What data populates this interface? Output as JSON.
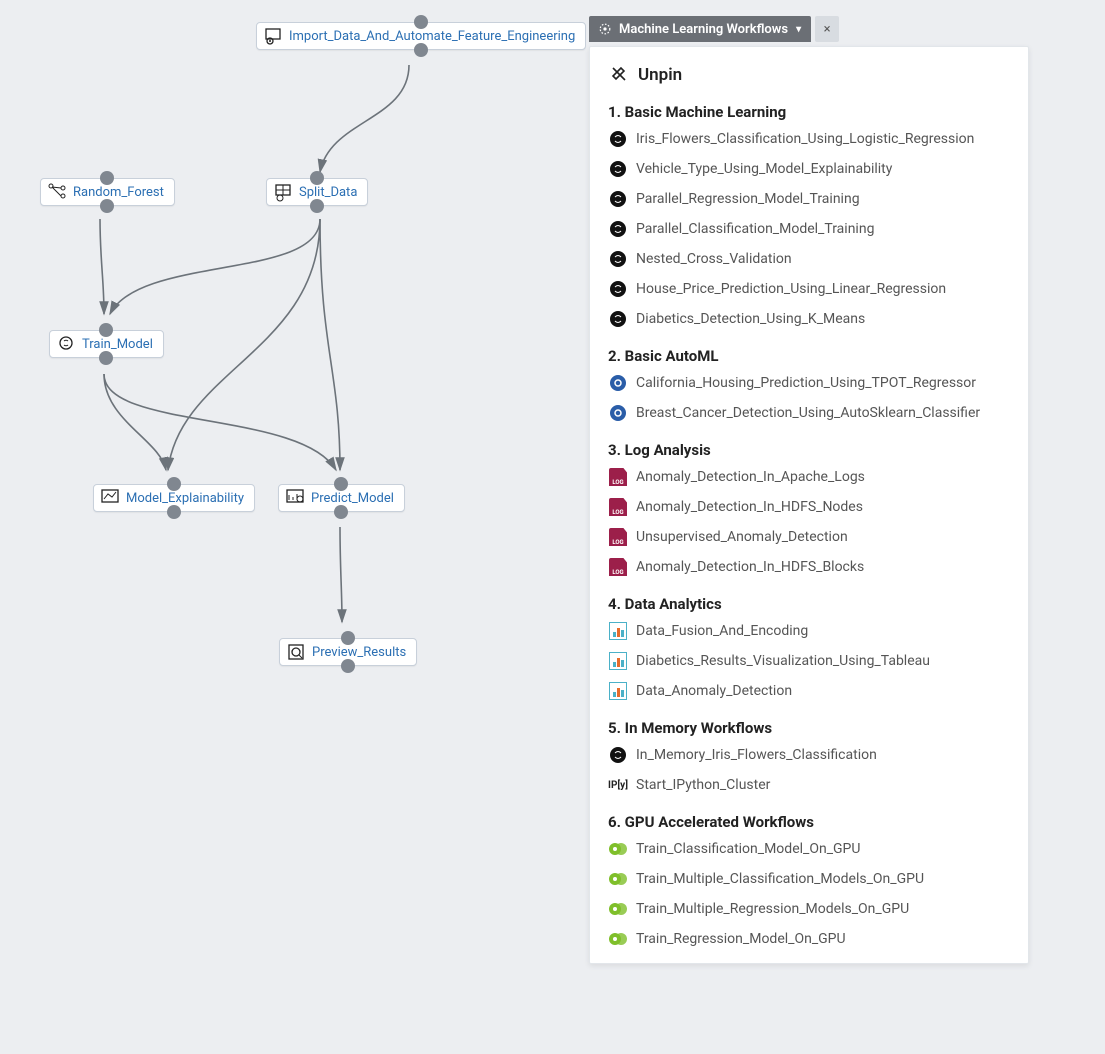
{
  "panel": {
    "tab_label": "Machine Learning Workflows",
    "unpin_label": "Unpin",
    "sections": {
      "s1": {
        "title": "1. Basic Machine Learning",
        "items": [
          "Iris_Flowers_Classification_Using_Logistic_Regression",
          "Vehicle_Type_Using_Model_Explainability",
          "Parallel_Regression_Model_Training",
          "Parallel_Classification_Model_Training",
          "Nested_Cross_Validation",
          "House_Price_Prediction_Using_Linear_Regression",
          "Diabetics_Detection_Using_K_Means"
        ]
      },
      "s2": {
        "title": "2. Basic AutoML",
        "items": [
          "California_Housing_Prediction_Using_TPOT_Regressor",
          "Breast_Cancer_Detection_Using_AutoSklearn_Classifier"
        ]
      },
      "s3": {
        "title": "3. Log Analysis",
        "items": [
          "Anomaly_Detection_In_Apache_Logs",
          "Anomaly_Detection_In_HDFS_Nodes",
          "Unsupervised_Anomaly_Detection",
          "Anomaly_Detection_In_HDFS_Blocks"
        ]
      },
      "s4": {
        "title": "4. Data Analytics",
        "items": [
          "Data_Fusion_And_Encoding",
          "Diabetics_Results_Visualization_Using_Tableau",
          "Data_Anomaly_Detection"
        ]
      },
      "s5": {
        "title": "5. In Memory Workflows",
        "items": [
          "In_Memory_Iris_Flowers_Classification",
          "Start_IPython_Cluster"
        ]
      },
      "s6": {
        "title": "6. GPU Accelerated Workflows",
        "items": [
          "Train_Classification_Model_On_GPU",
          "Train_Multiple_Classification_Models_On_GPU",
          "Train_Multiple_Regression_Models_On_GPU",
          "Train_Regression_Model_On_GPU"
        ]
      }
    }
  },
  "nodes": {
    "n1": {
      "label": "Import_Data_And_Automate_Feature_Engineering"
    },
    "n2": {
      "label": "Random_Forest"
    },
    "n3": {
      "label": "Split_Data"
    },
    "n4": {
      "label": "Train_Model"
    },
    "n5": {
      "label": "Model_Explainability"
    },
    "n6": {
      "label": "Predict_Model"
    },
    "n7": {
      "label": "Preview_Results"
    }
  }
}
